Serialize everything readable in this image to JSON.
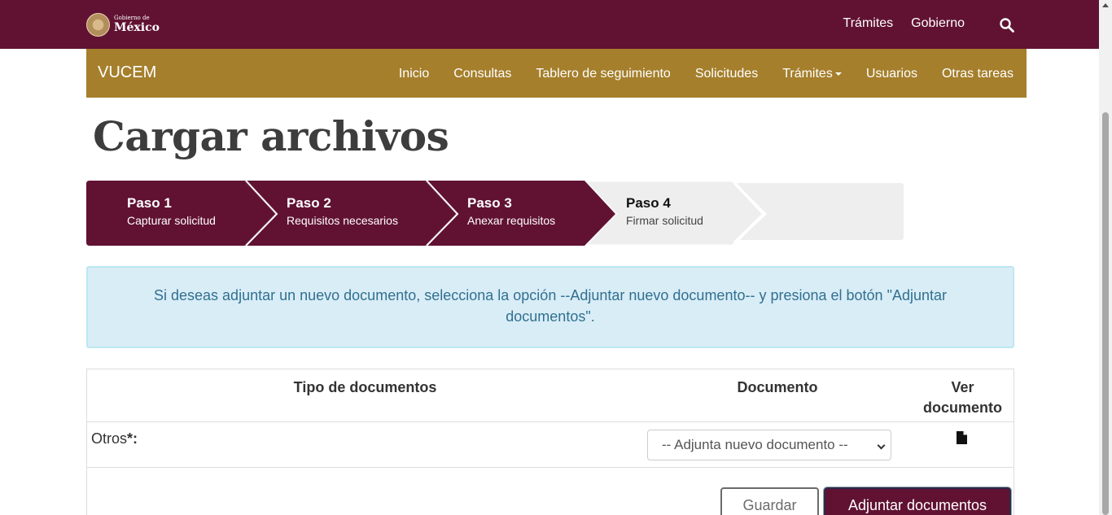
{
  "gov_header": {
    "logo_small": "Gobierno de",
    "logo_big": "México",
    "links": [
      "Trámites",
      "Gobierno"
    ],
    "search_icon": "search-icon"
  },
  "vucem": {
    "title": "VUCEM",
    "nav": [
      "Inicio",
      "Consultas",
      "Tablero de seguimiento",
      "Solicitudes",
      "Trámites",
      "Usuarios",
      "Otras tareas"
    ]
  },
  "page": {
    "title": "Cargar archivos"
  },
  "stepper": {
    "steps": [
      {
        "title": "Paso 1",
        "subtitle": "Capturar solicitud",
        "state": "done"
      },
      {
        "title": "Paso 2",
        "subtitle": "Requisitos necesarios",
        "state": "done"
      },
      {
        "title": "Paso 3",
        "subtitle": "Anexar requisitos",
        "state": "done"
      },
      {
        "title": "Paso 4",
        "subtitle": "Firmar solicitud",
        "state": "current"
      }
    ],
    "colors": {
      "done": "#611232",
      "pending": "#eeeeee"
    }
  },
  "alert": {
    "text": "Si deseas adjuntar un nuevo documento, selecciona la opción --Adjuntar nuevo documento-- y presiona el botón \"Adjuntar documentos\"."
  },
  "table": {
    "headers": {
      "tipo": "Tipo de documentos",
      "documento": "Documento",
      "ver_line1": "Ver",
      "ver_line2": "documento"
    },
    "rows": [
      {
        "tipo": "Otros",
        "required_mark": "*:",
        "select_value": "-- Adjunta nuevo documento --",
        "view_icon": "file-icon"
      }
    ]
  },
  "buttons": {
    "guardar": "Guardar",
    "adjuntar": "Adjuntar documentos"
  },
  "colors": {
    "brand": "#611232",
    "gold": "#a57f2c",
    "alert_bg": "#d9edf7",
    "alert_text": "#31708f"
  }
}
